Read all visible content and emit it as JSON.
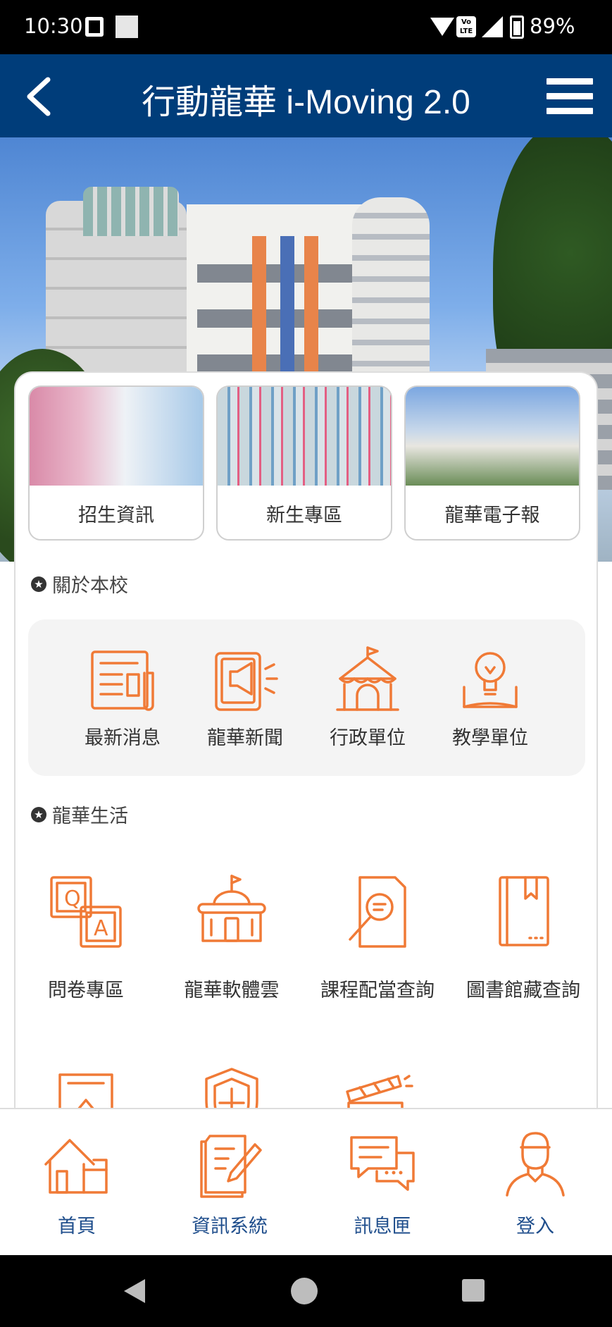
{
  "status_bar": {
    "time": "10:30",
    "volte": "Vo LTE",
    "battery": "89%"
  },
  "header": {
    "title": "行動龍華 i-Moving 2.0",
    "back_icon": "chevron-left-icon",
    "menu_icon": "hamburger-menu-icon"
  },
  "quick_links": [
    {
      "label": "招生資訊"
    },
    {
      "label": "新生專區"
    },
    {
      "label": "龍華電子報"
    }
  ],
  "about": {
    "heading": "關於本校",
    "items": [
      {
        "label": "最新消息",
        "icon": "news-icon"
      },
      {
        "label": "龍華新聞",
        "icon": "megaphone-icon"
      },
      {
        "label": "行政單位",
        "icon": "tent-icon"
      },
      {
        "label": "教學單位",
        "icon": "lightbulb-book-icon"
      }
    ]
  },
  "life": {
    "heading": "龍華生活",
    "items": [
      {
        "label": "問卷專區",
        "icon": "qa-icon"
      },
      {
        "label": "龍華軟體雲",
        "icon": "school-icon"
      },
      {
        "label": "課程配當查詢",
        "icon": "document-search-icon"
      },
      {
        "label": "圖書館藏查詢",
        "icon": "book-icon"
      }
    ],
    "partial_row_icons": [
      "certificate-icon",
      "shield-icon",
      "clapperboard-icon"
    ]
  },
  "bottom_nav": [
    {
      "label": "首頁",
      "icon": "home-icon"
    },
    {
      "label": "資訊系統",
      "icon": "edit-document-icon"
    },
    {
      "label": "訊息匣",
      "icon": "chat-bubbles-icon"
    },
    {
      "label": "登入",
      "icon": "user-icon"
    }
  ],
  "colors": {
    "header_bg": "#003d7a",
    "icon_orange": "#f07a36",
    "nav_label_blue": "#1f4e8c"
  }
}
